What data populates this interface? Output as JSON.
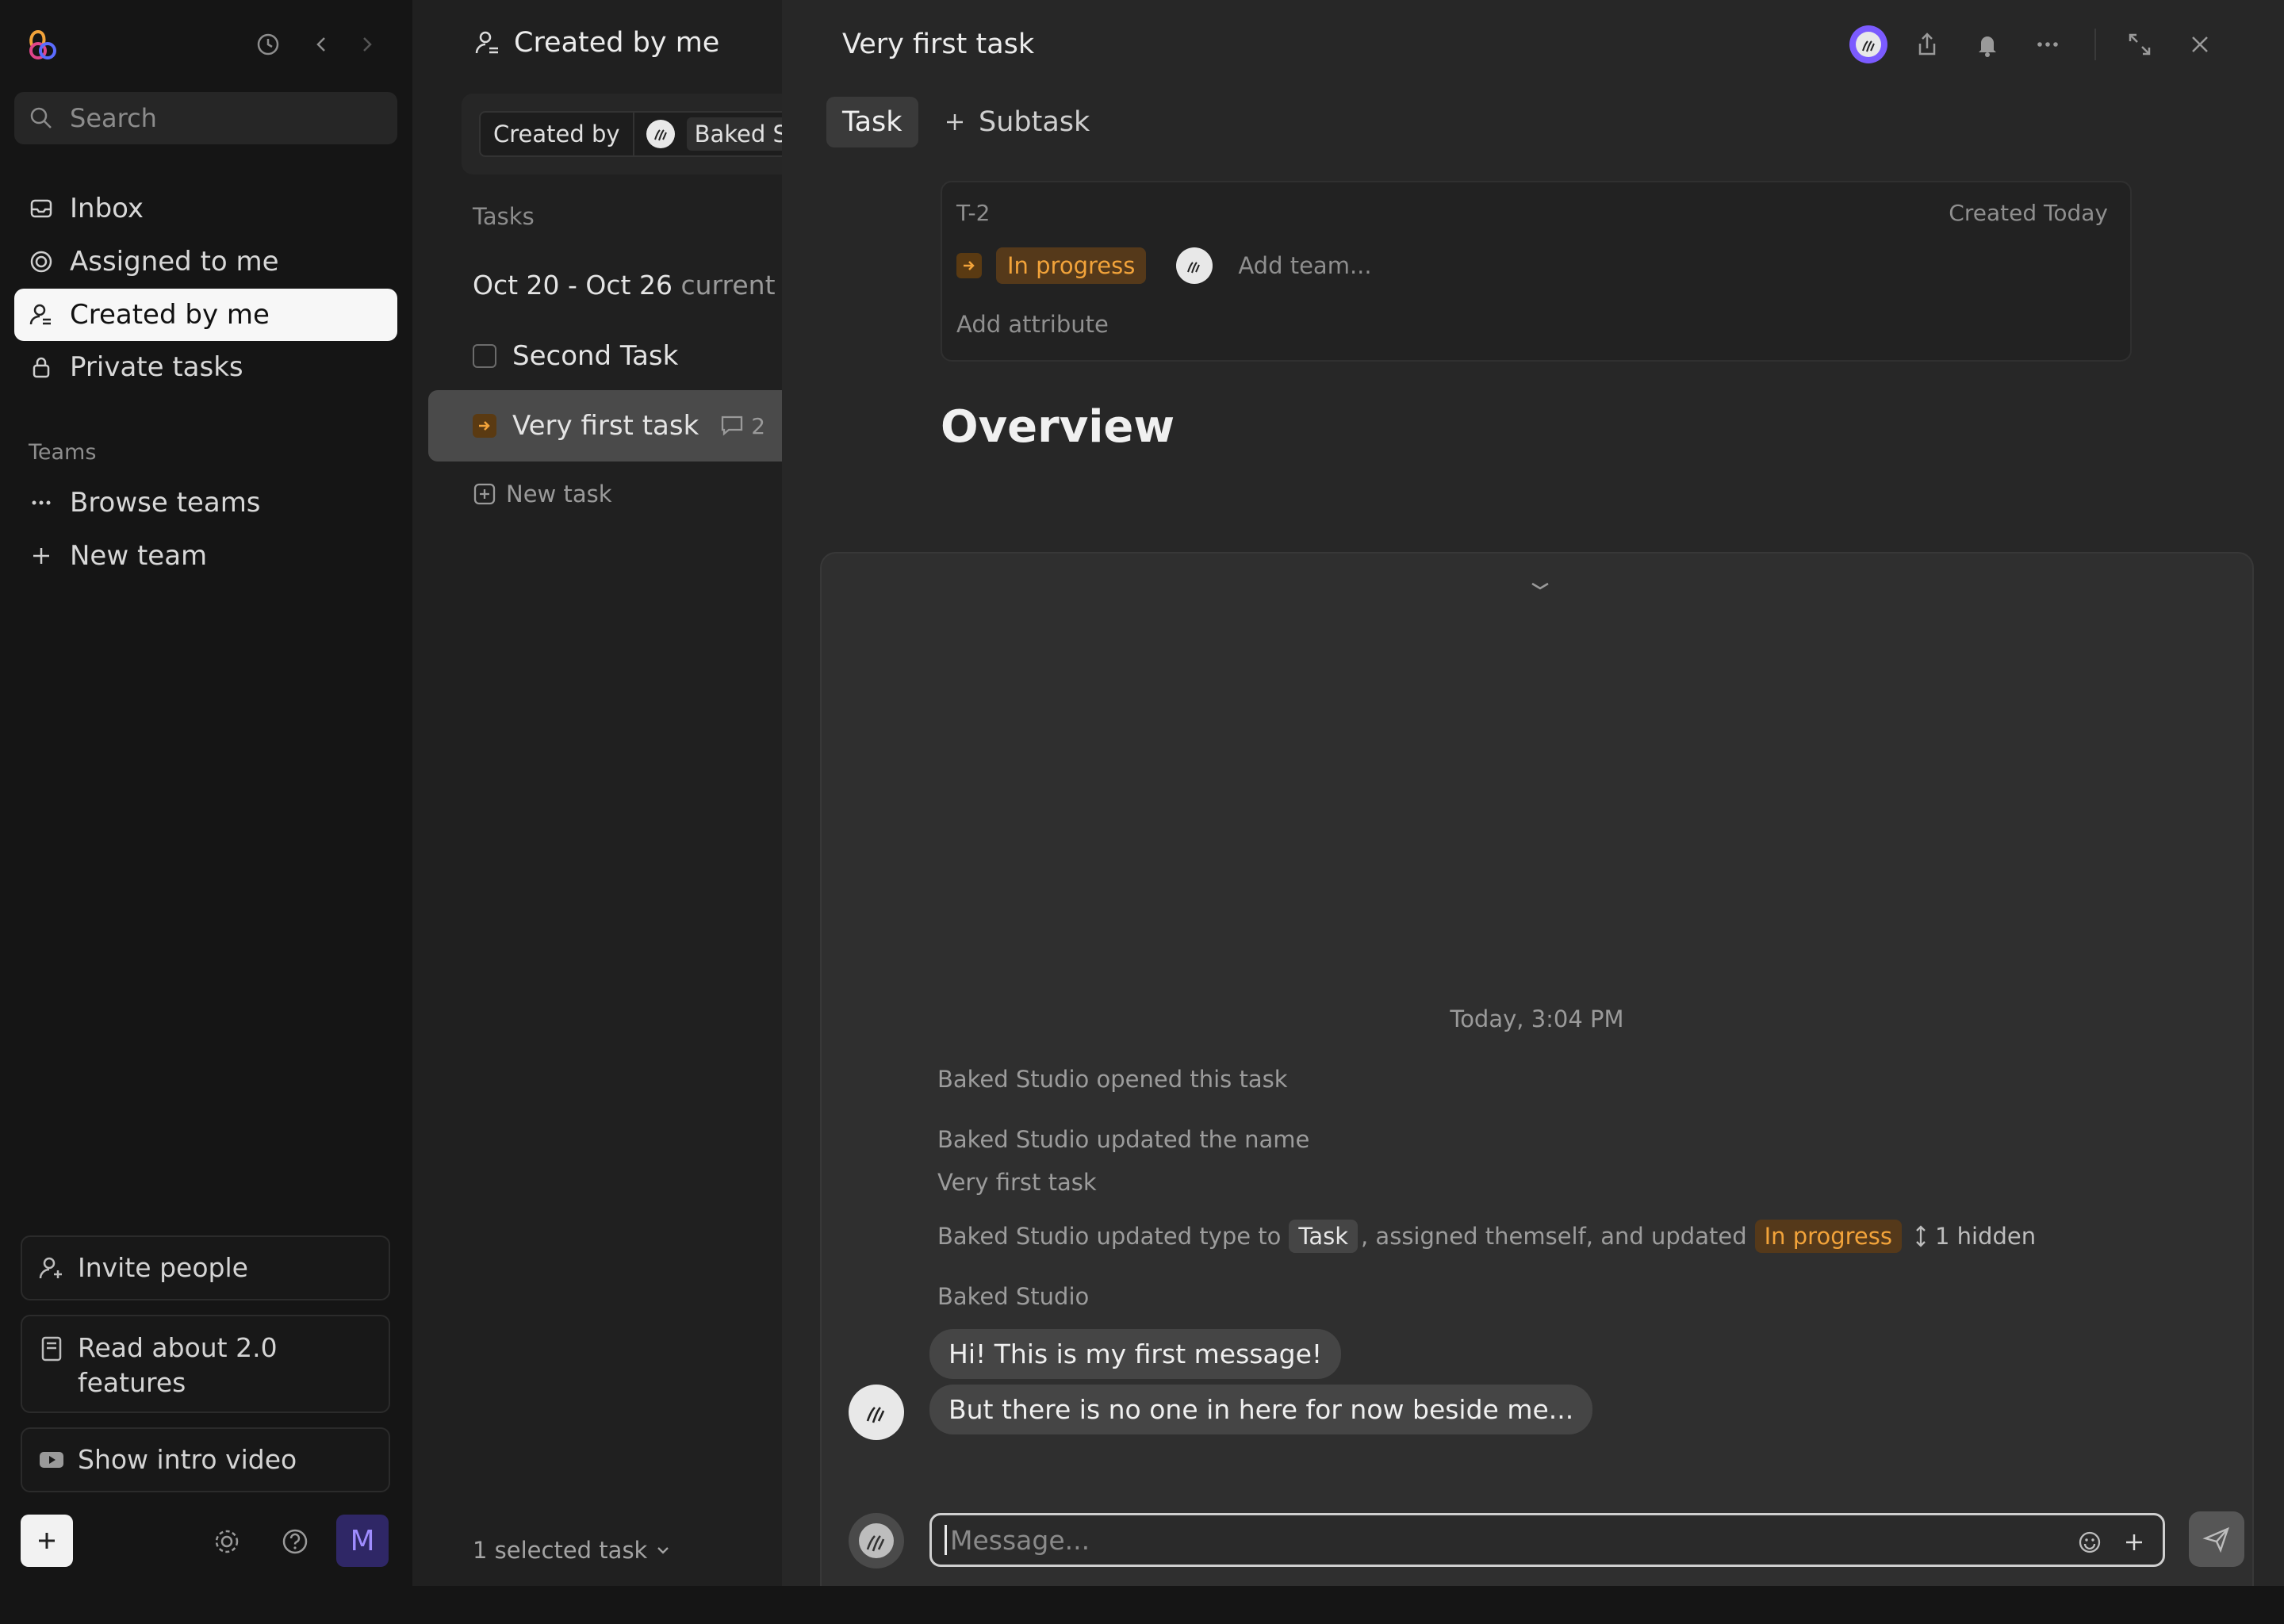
{
  "sidebar": {
    "search_placeholder": "Search",
    "nav": [
      {
        "label": "Inbox",
        "icon": "inbox-icon"
      },
      {
        "label": "Assigned to me",
        "icon": "target-icon"
      },
      {
        "label": "Created by me",
        "icon": "user-icon",
        "active": true
      },
      {
        "label": "Private tasks",
        "icon": "lock-icon"
      }
    ],
    "teams_label": "Teams",
    "teams": [
      {
        "label": "Browse teams",
        "icon": "more-dots-icon"
      },
      {
        "label": "New team",
        "icon": "plus-icon"
      }
    ],
    "bottom": {
      "invite": "Invite people",
      "read_about": "Read about 2.0 features",
      "intro_video": "Show intro video"
    },
    "user_initial": "M"
  },
  "list": {
    "title": "Created by me",
    "filter": {
      "key": "Created by",
      "value": "Baked Studio"
    },
    "tasks_label": "Tasks",
    "week": {
      "range": "Oct 20 - Oct 26",
      "current": "current week"
    },
    "tasks": [
      {
        "name": "Second Task",
        "status": "todo"
      },
      {
        "name": "Very first task",
        "status": "in-progress",
        "comments": "2",
        "selected": true
      }
    ],
    "new_task": "New task",
    "selected_count": "1 selected task"
  },
  "detail": {
    "title": "Very first task",
    "tabs": {
      "task": "Task",
      "subtask": "Subtask"
    },
    "attributes": {
      "id": "T-2",
      "created": "Created Today",
      "status": "In progress",
      "add_team": "Add team...",
      "add_attribute": "Add attribute"
    },
    "overview": "Overview",
    "activity": {
      "timestamp": "Today, 3:04 PM",
      "opened": "Baked Studio opened this task",
      "updated_name": "Baked Studio updated the name",
      "new_name": "Very first task",
      "updated_type_prefix": "Baked Studio updated type to",
      "type_tag": "Task",
      "updated_type_mid": ", assigned themself, and updated",
      "status_tag": "In progress",
      "hidden": "1 hidden",
      "author": "Baked Studio",
      "messages": [
        "Hi! This is my first message!",
        "But there is no one in here for now beside me..."
      ]
    },
    "composer_placeholder": "Message..."
  },
  "colors": {
    "accent_orange": "#f2a33a",
    "user_purple": "#7b5bff",
    "active_nav_bg": "#f7f7f7"
  }
}
